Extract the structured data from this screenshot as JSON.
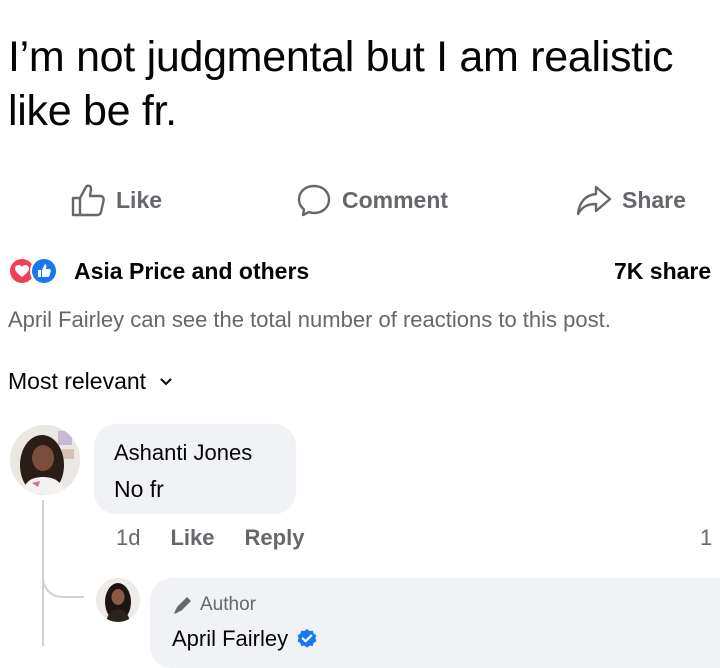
{
  "post": {
    "text": "I’m not judgmental but I am realistic like be fr."
  },
  "actions": {
    "like": "Like",
    "comment": "Comment",
    "share": "Share"
  },
  "reactions": {
    "reactors": "Asia Price and others",
    "shares": "7K share",
    "icons": [
      "heart-icon",
      "thumbs-up-icon"
    ],
    "colors": {
      "heart": "#f33e58",
      "like": "#1877f2"
    }
  },
  "visibility_note": "April Fairley can see the total number of reactions to this post.",
  "sort": {
    "label": "Most relevant"
  },
  "comments": [
    {
      "author": "Ashanti Jones",
      "text": "No fr",
      "time": "1d",
      "like": "Like",
      "reply": "Reply",
      "reaction_count": "1"
    }
  ],
  "reply": {
    "badge": "Author",
    "author": "April Fairley",
    "verified": true
  }
}
